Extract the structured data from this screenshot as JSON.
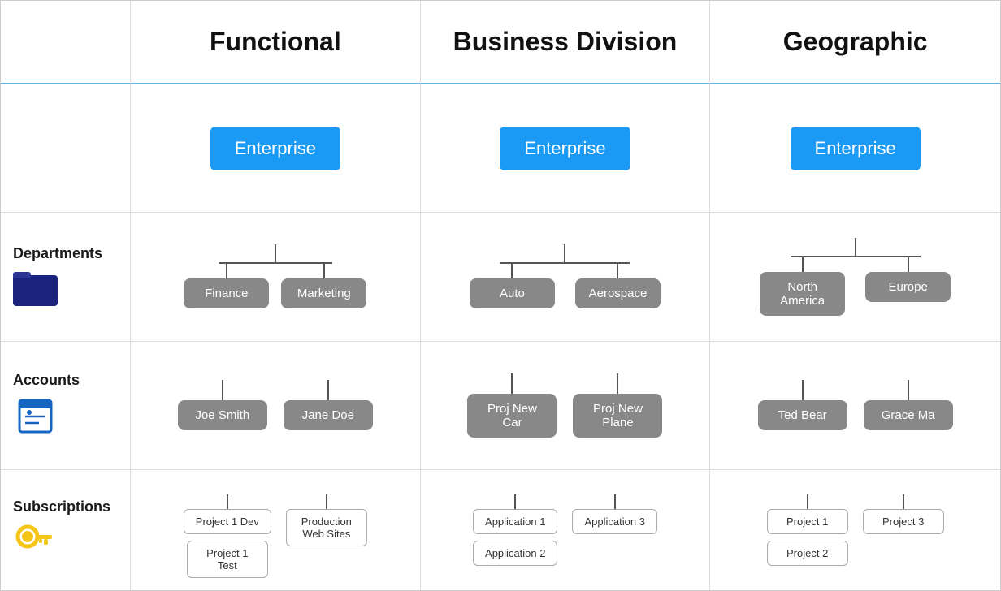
{
  "headers": {
    "functional": "Functional",
    "businessDivision": "Business Division",
    "geographic": "Geographic"
  },
  "rowLabels": {
    "departments": "Departments",
    "accounts": "Accounts",
    "subscriptions": "Subscriptions"
  },
  "enterprise": "Enterprise",
  "functional": {
    "departments": [
      "Finance",
      "Marketing"
    ],
    "accounts": {
      "Finance": [
        "Joe Smith"
      ],
      "Marketing": [
        "Jane Doe"
      ]
    },
    "subscriptions": {
      "JoeSmith": [
        "Project 1 Dev",
        "Project 1 Test"
      ],
      "JaneDoe": [
        "Production Web Sites"
      ]
    }
  },
  "businessDivision": {
    "departments": [
      "Auto",
      "Aerospace"
    ],
    "accounts": {
      "Auto": [
        "Proj New Car"
      ],
      "Aerospace": [
        "Proj New Plane"
      ]
    },
    "subscriptions": {
      "Auto": [
        "Application 1",
        "Application 2"
      ],
      "Aerospace": [
        "Application 3"
      ]
    }
  },
  "geographic": {
    "departments": [
      "North America",
      "Europe"
    ],
    "accounts": {
      "NorthAmerica": [
        "Ted Bear"
      ],
      "Europe": [
        "Grace Ma"
      ]
    },
    "subscriptions": {
      "TedBear": [
        "Project 1",
        "Project 2"
      ],
      "GraceMa": [
        "Project 3"
      ]
    }
  }
}
